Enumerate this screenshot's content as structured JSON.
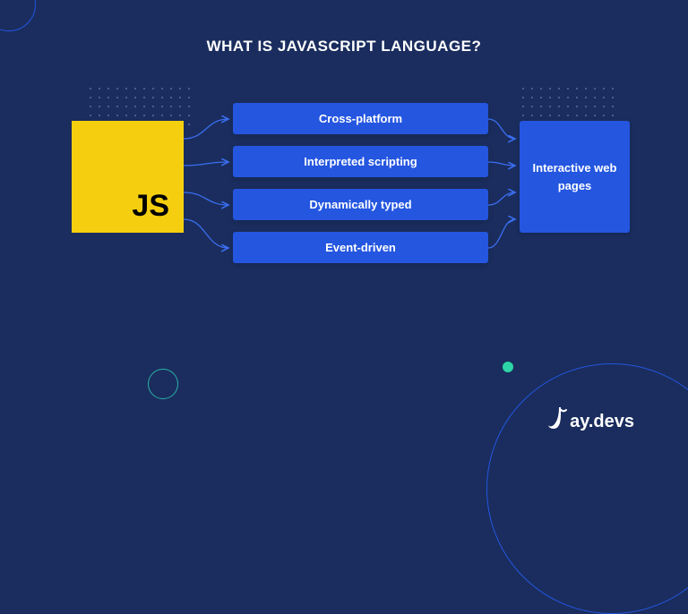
{
  "title": "WHAT IS JAVASCRIPT LANGUAGE?",
  "source": {
    "icon_text": "JS"
  },
  "features": [
    "Cross-platform",
    "Interpreted scripting",
    "Dynamically typed",
    "Event-driven"
  ],
  "output": "Interactive web pages",
  "brand": {
    "name": "ay.devs"
  },
  "colors": {
    "background": "#1a2d5e",
    "accent_blue": "#2456e0",
    "js_yellow": "#f5cf0f",
    "teal": "#2dd4a7"
  }
}
